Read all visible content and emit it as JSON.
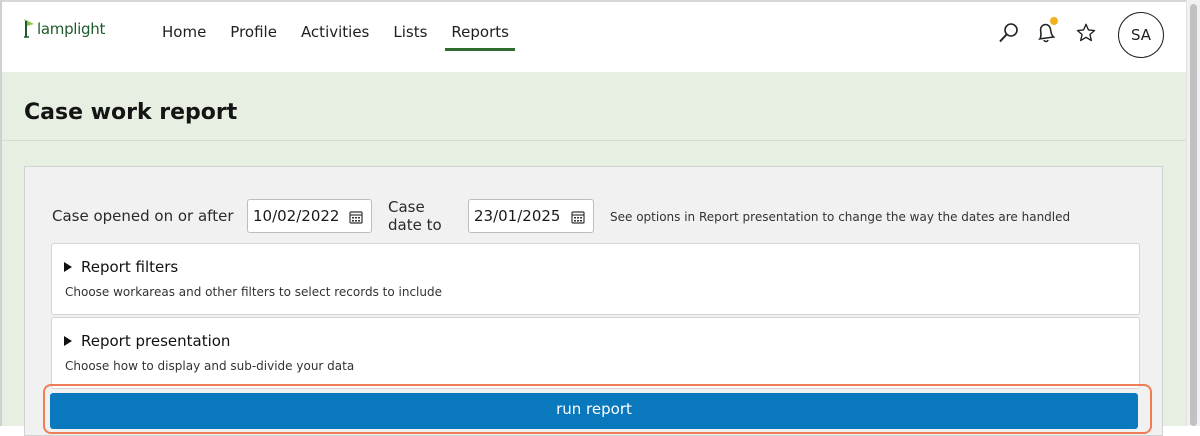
{
  "app": {
    "logo_text": "lamplight",
    "brand_color": "#1e5b2c"
  },
  "nav": {
    "items": [
      {
        "label": "Home",
        "active": false
      },
      {
        "label": "Profile",
        "active": false
      },
      {
        "label": "Activities",
        "active": false
      },
      {
        "label": "Lists",
        "active": false
      },
      {
        "label": "Reports",
        "active": true
      }
    ]
  },
  "header": {
    "icons": [
      "search-icon",
      "bell-icon",
      "star-icon"
    ],
    "notification_dot_color": "#f2b01e",
    "avatar_initials": "SA"
  },
  "page": {
    "title": "Case work report",
    "background_color": "#e6efe2"
  },
  "form": {
    "opened_label": "Case opened on or after",
    "opened_value": "10/02/2022",
    "date_to_label_line1": "Case",
    "date_to_label_line2": "date to",
    "date_to_value": "23/01/2025",
    "hint": "See options in Report presentation to change the way the dates are handled"
  },
  "sections": [
    {
      "title": "Report filters",
      "description": "Choose workareas and other filters to select records to include"
    },
    {
      "title": "Report presentation",
      "description": "Choose how to display and sub-divide your data"
    }
  ],
  "run_button": {
    "label": "run report",
    "color": "#0a78bd",
    "highlight_color": "#ef7d55"
  }
}
